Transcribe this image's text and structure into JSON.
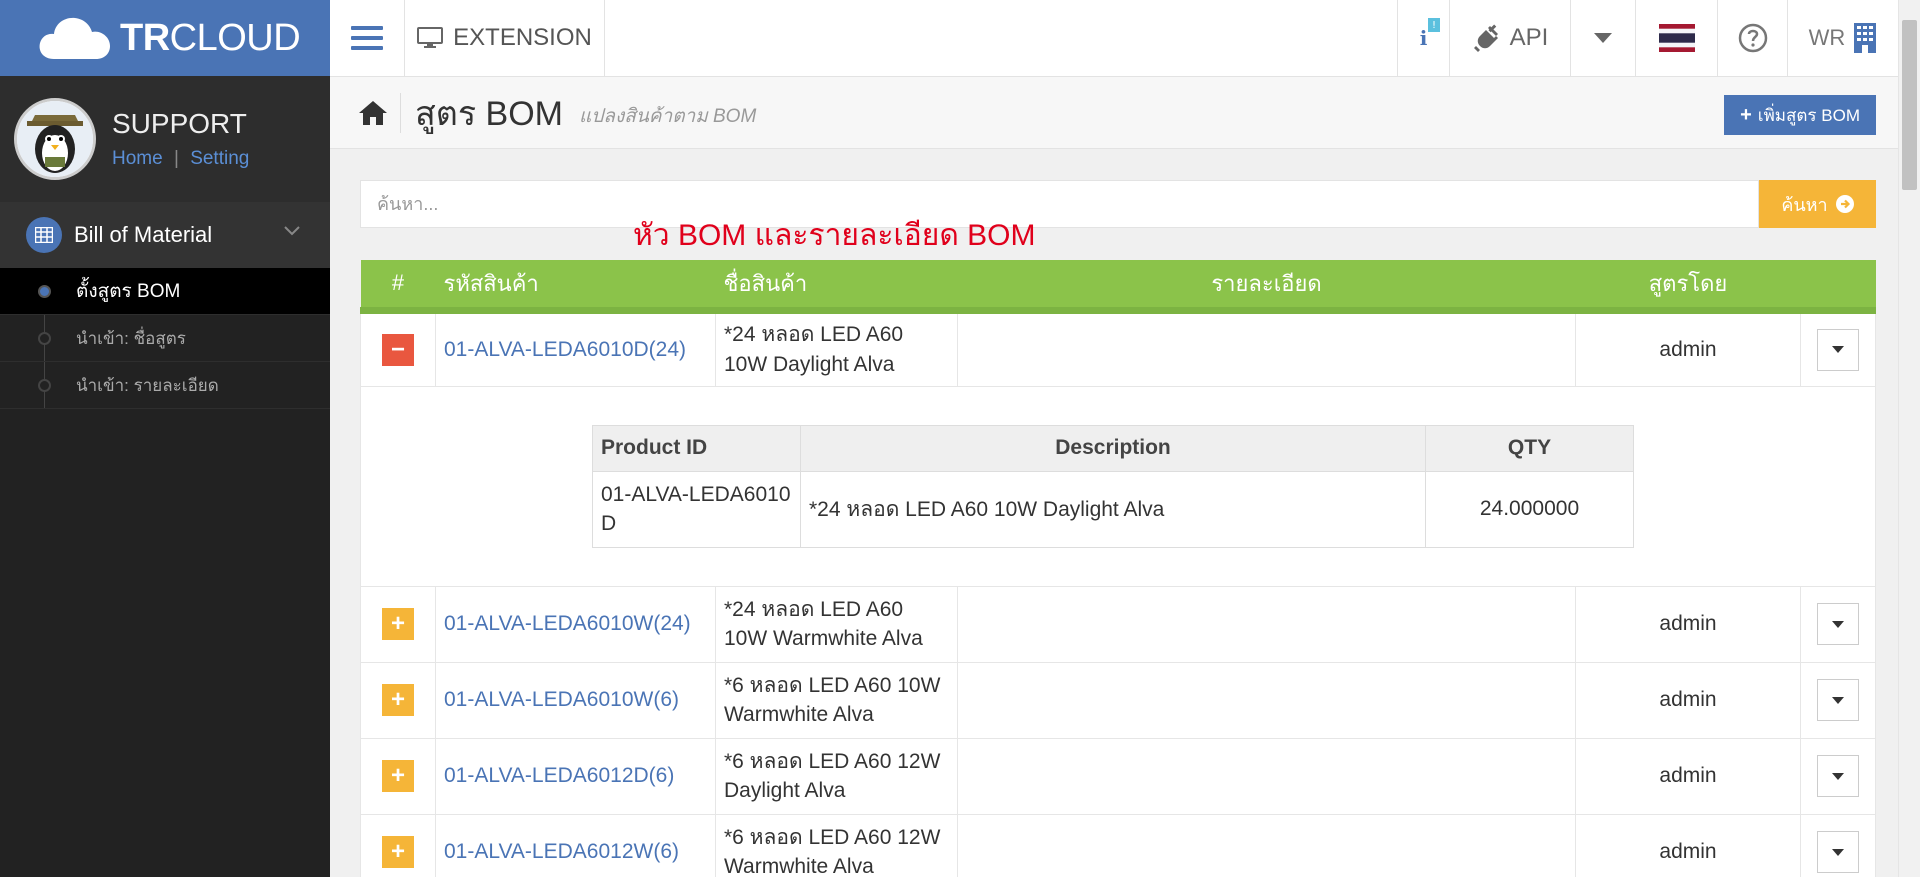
{
  "brand": {
    "logo_bold": "TR",
    "logo_light": "CLOUD",
    "color": "#4a74b5"
  },
  "topbar": {
    "extension_label": "EXTENSION",
    "info_badge": "!",
    "api_label": "API",
    "user_initials": "WR"
  },
  "profile": {
    "name": "SUPPORT",
    "home_link": "Home",
    "separator": "|",
    "setting_link": "Setting"
  },
  "menu": {
    "title": "Bill of Material",
    "items": [
      {
        "label": "ตั้งสูตร BOM",
        "active": true
      },
      {
        "label": "นำเข้า: ชื่อสูตร",
        "active": false
      },
      {
        "label": "นำเข้า: รายละเอียด",
        "active": false
      }
    ]
  },
  "page": {
    "title": "สูตร BOM",
    "subtitle": "แปลงสินค้าตาม BOM",
    "add_button": "เพิ่มสูตร BOM"
  },
  "search": {
    "placeholder": "ค้นหา...",
    "button": "ค้นหา"
  },
  "annotation": "หัว BOM และรายละเอียด BOM",
  "table": {
    "headers": {
      "index": "#",
      "code": "รหัสสินค้า",
      "name": "ชื่อสินค้า",
      "detail": "รายละเอียด",
      "by": "สูตรโดย"
    },
    "rows": [
      {
        "code": "01-ALVA-LEDA6010D(24)",
        "name": "*24 หลอด LED A60 10W Daylight Alva",
        "detail": "",
        "by": "admin",
        "expanded": true
      },
      {
        "code": "01-ALVA-LEDA6010W(24)",
        "name": "*24 หลอด LED A60 10W Warmwhite Alva",
        "detail": "",
        "by": "admin",
        "expanded": false
      },
      {
        "code": "01-ALVA-LEDA6010W(6)",
        "name": "*6 หลอด LED A60 10W Warmwhite Alva",
        "detail": "",
        "by": "admin",
        "expanded": false
      },
      {
        "code": "01-ALVA-LEDA6012D(6)",
        "name": "*6 หลอด LED A60 12W Daylight Alva",
        "detail": "",
        "by": "admin",
        "expanded": false
      },
      {
        "code": "01-ALVA-LEDA6012W(6)",
        "name": "*6 หลอด LED A60 12W Warmwhite Alva",
        "detail": "",
        "by": "admin",
        "expanded": false
      }
    ],
    "detail": {
      "headers": {
        "product_id": "Product ID",
        "description": "Description",
        "qty": "QTY"
      },
      "rows": [
        {
          "product_id": "01-ALVA-LEDA6010D",
          "description": "*24 หลอด LED A60 10W Daylight Alva",
          "qty": "24.000000"
        }
      ]
    }
  },
  "colors": {
    "header_green": "#8bc34a",
    "minus_red": "#e9573f",
    "plus_yellow": "#f5b538",
    "annotation_red": "#e0001b"
  },
  "icons": {
    "hamburger": "hamburger-icon",
    "monitor": "monitor-icon",
    "info": "info-icon",
    "plug": "plug-icon",
    "caret": "caret-down-icon",
    "flag": "thai-flag-icon",
    "help": "help-icon",
    "building": "building-icon",
    "home": "home-icon",
    "plus": "plus-icon",
    "arrow": "arrow-right-circle-icon",
    "table": "table-icon"
  }
}
